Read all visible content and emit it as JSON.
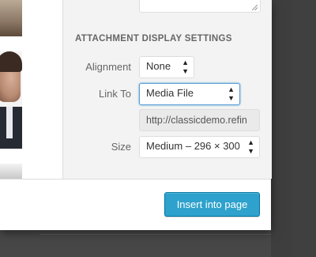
{
  "attachment_display": {
    "heading": "ATTACHMENT DISPLAY SETTINGS",
    "alignment": {
      "label": "Alignment",
      "value": "None"
    },
    "link_to": {
      "label": "Link To",
      "value": "Media File",
      "url": "http://classicdemo.refin"
    },
    "size": {
      "label": "Size",
      "value": "Medium – 296 × 300"
    }
  },
  "toolbar": {
    "insert_label": "Insert into page"
  },
  "colors": {
    "primary_button": "#2ea2cc",
    "sidebar_bg": "#f3f3f3",
    "focus_ring": "#5b9dd9"
  },
  "icons": {
    "select_arrows": "updown-arrows-icon",
    "resize": "resize-grip-icon"
  }
}
